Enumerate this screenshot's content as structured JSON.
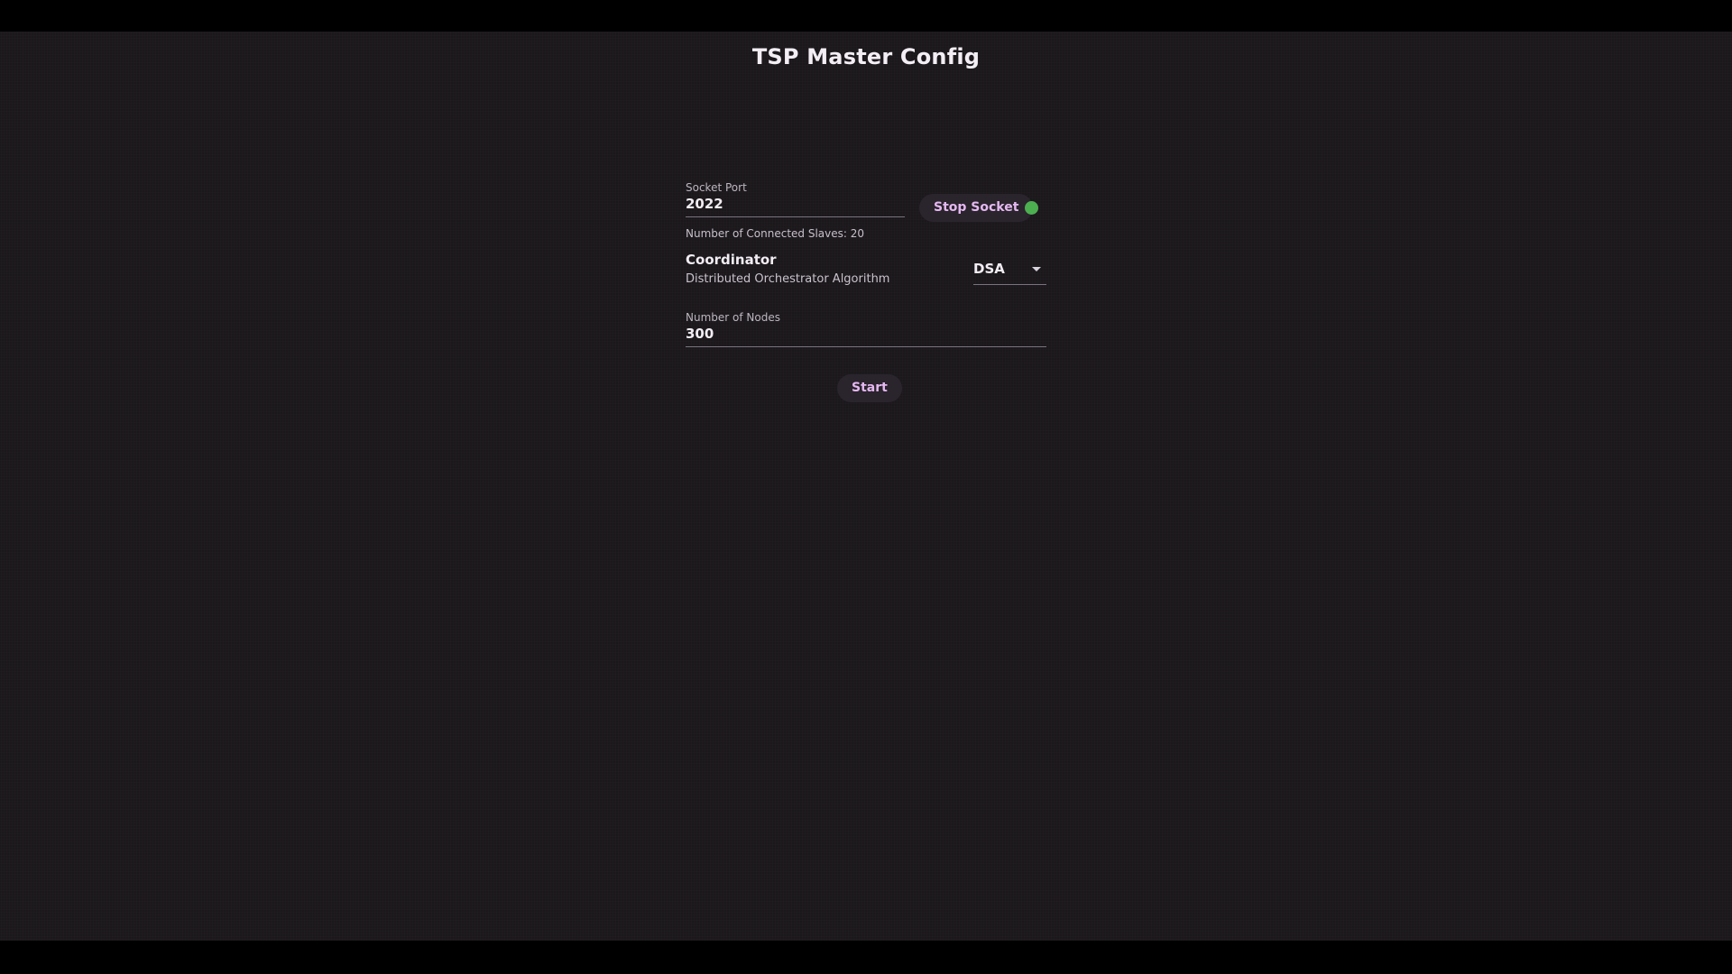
{
  "app": {
    "title": "TSP Master Config"
  },
  "socket": {
    "label": "Socket Port",
    "value": "2022",
    "button_label": "Stop Socket",
    "status_color": "#4caf50",
    "connected_text": "Number of Connected Slaves: 20"
  },
  "coordinator": {
    "title": "Coordinator",
    "subtitle": "Distributed Orchestrator Algorithm",
    "selected": "DSA"
  },
  "nodes": {
    "label": "Number of Nodes",
    "value": "300"
  },
  "actions": {
    "start_label": "Start"
  },
  "colors": {
    "background": "#1b181c",
    "button_bg": "#2a242d",
    "button_text": "#e4b8f0"
  }
}
